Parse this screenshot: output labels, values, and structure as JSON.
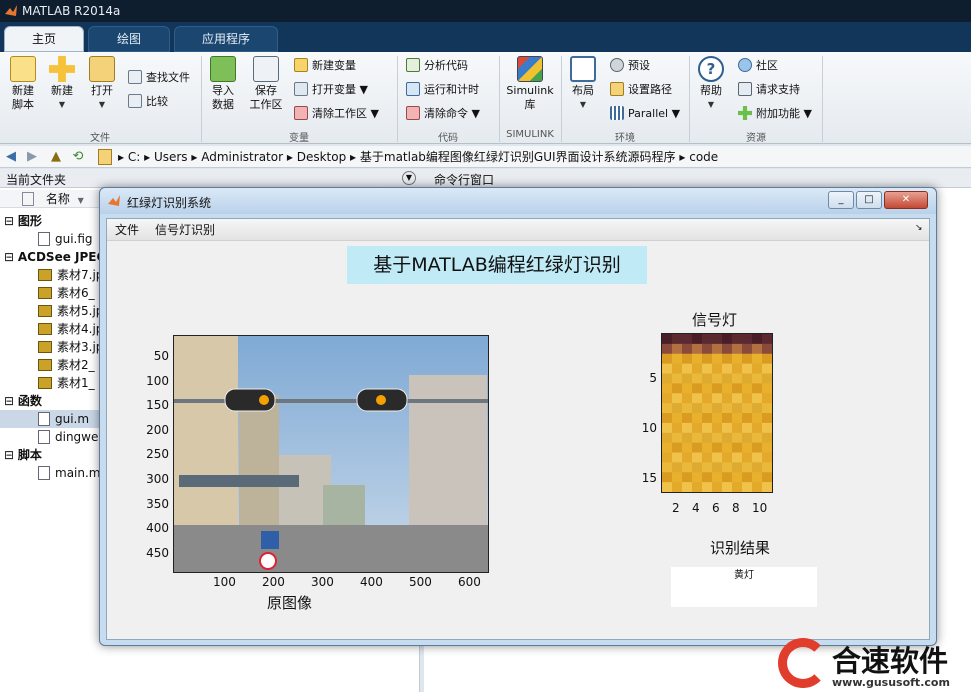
{
  "window": {
    "title": "MATLAB R2014a"
  },
  "tabs": [
    {
      "label": "主页",
      "active": true
    },
    {
      "label": "绘图",
      "active": false
    },
    {
      "label": "应用程序",
      "active": false
    }
  ],
  "ribbon": {
    "groups": [
      {
        "label": "文件",
        "big": [
          {
            "label1": "新建",
            "label2": "脚本"
          },
          {
            "label1": "新建",
            "label2": "▼"
          },
          {
            "label1": "打开",
            "label2": "▼"
          }
        ],
        "small": [
          {
            "label": "查找文件"
          },
          {
            "label": "比较"
          }
        ]
      },
      {
        "label": "变量",
        "big": [
          {
            "label1": "导入",
            "label2": "数据"
          },
          {
            "label1": "保存",
            "label2": "工作区"
          }
        ],
        "small": [
          {
            "label": "新建变量"
          },
          {
            "label": "打开变量 ▼"
          },
          {
            "label": "清除工作区 ▼"
          }
        ]
      },
      {
        "label": "代码",
        "small": [
          {
            "label": "分析代码"
          },
          {
            "label": "运行和计时"
          },
          {
            "label": "清除命令 ▼"
          }
        ]
      },
      {
        "label": "SIMULINK",
        "big": [
          {
            "label1": "Simulink",
            "label2": "库"
          }
        ]
      },
      {
        "label": "环境",
        "big": [
          {
            "label1": "布局",
            "label2": "▼"
          }
        ],
        "small": [
          {
            "label": "预设"
          },
          {
            "label": "设置路径"
          },
          {
            "label": "Parallel ▼"
          }
        ]
      },
      {
        "label": "资源",
        "big": [
          {
            "label1": "帮助",
            "label2": "▼"
          }
        ],
        "small": [
          {
            "label": "社区"
          },
          {
            "label": "请求支持"
          },
          {
            "label": "附加功能 ▼"
          }
        ]
      }
    ]
  },
  "address": {
    "crumbs": [
      "C:",
      "Users",
      "Administrator",
      "Desktop",
      "基于matlab编程图像红绿灯识别GUI界面设计系统源码程序",
      "code"
    ]
  },
  "panels": {
    "file_title": "当前文件夹",
    "cmd_title": "命令行窗口",
    "col_name": "名称"
  },
  "files": [
    {
      "text": "图形",
      "kind": "group"
    },
    {
      "text": "gui.fig",
      "kind": "fig"
    },
    {
      "text": "ACDSee JPEG",
      "kind": "group"
    },
    {
      "text": "素材7.jp",
      "kind": "jpg"
    },
    {
      "text": "素材6_",
      "kind": "jpg"
    },
    {
      "text": "素材5.jp",
      "kind": "jpg"
    },
    {
      "text": "素材4.jp",
      "kind": "jpg"
    },
    {
      "text": "素材3.jp",
      "kind": "jpg"
    },
    {
      "text": "素材2_",
      "kind": "jpg"
    },
    {
      "text": "素材1_",
      "kind": "jpg"
    },
    {
      "text": "函数",
      "kind": "group"
    },
    {
      "text": "gui.m",
      "kind": "m",
      "selected": true
    },
    {
      "text": "dingwe",
      "kind": "m"
    },
    {
      "text": "脚本",
      "kind": "group"
    },
    {
      "text": "main.m",
      "kind": "m"
    }
  ],
  "dialog": {
    "title": "红绿灯识别系统",
    "menus": [
      "文件",
      "信号灯识别"
    ],
    "heading": "基于MATLAB编程红绿灯识别",
    "image_axes": {
      "xlabel": "原图像",
      "xticks": [
        "100",
        "200",
        "300",
        "400",
        "500",
        "600"
      ],
      "yticks": [
        "50",
        "100",
        "150",
        "200",
        "250",
        "300",
        "350",
        "400",
        "450"
      ]
    },
    "signal_axes": {
      "title": "信号灯",
      "xticks": [
        "2",
        "4",
        "6",
        "8",
        "10"
      ],
      "yticks": [
        "5",
        "10",
        "15"
      ]
    },
    "result": {
      "title": "识别结果",
      "value": "黄灯"
    }
  },
  "watermark": {
    "text": "合速软件",
    "url": "www.gususoft.com"
  },
  "colors": {
    "accent": "#11365a",
    "heading_bg": "#bfeaf6",
    "light": "#f4a000"
  }
}
